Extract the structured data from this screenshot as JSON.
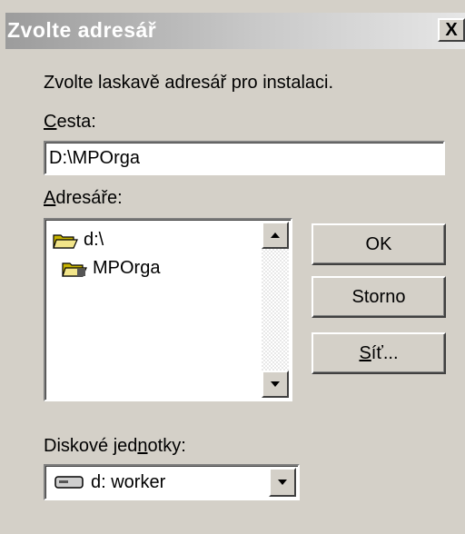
{
  "dialog": {
    "title": "Zvolte adresář",
    "close_label": "X",
    "prompt": "Zvolte laskavě adresář pro instalaci."
  },
  "path": {
    "label_accel": "C",
    "label_rest": "esta:",
    "value": "D:\\MPOrga"
  },
  "directories": {
    "label_accel": "A",
    "label_rest": "dresáře:",
    "items": [
      "d:\\",
      "MPOrga"
    ]
  },
  "buttons": {
    "ok": "OK",
    "cancel": "Storno",
    "network_accel": "S",
    "network_rest": "íť..."
  },
  "drives": {
    "label_pre": "Diskové jed",
    "label_accel": "n",
    "label_post": "otky:",
    "selected": "d: worker"
  },
  "icons": {
    "close": "close-icon",
    "folder_open": "folder-open-icon",
    "scroll_up": "arrow-up-icon",
    "scroll_down": "arrow-down-icon",
    "drive": "drive-icon",
    "dropdown": "chevron-down-icon"
  }
}
